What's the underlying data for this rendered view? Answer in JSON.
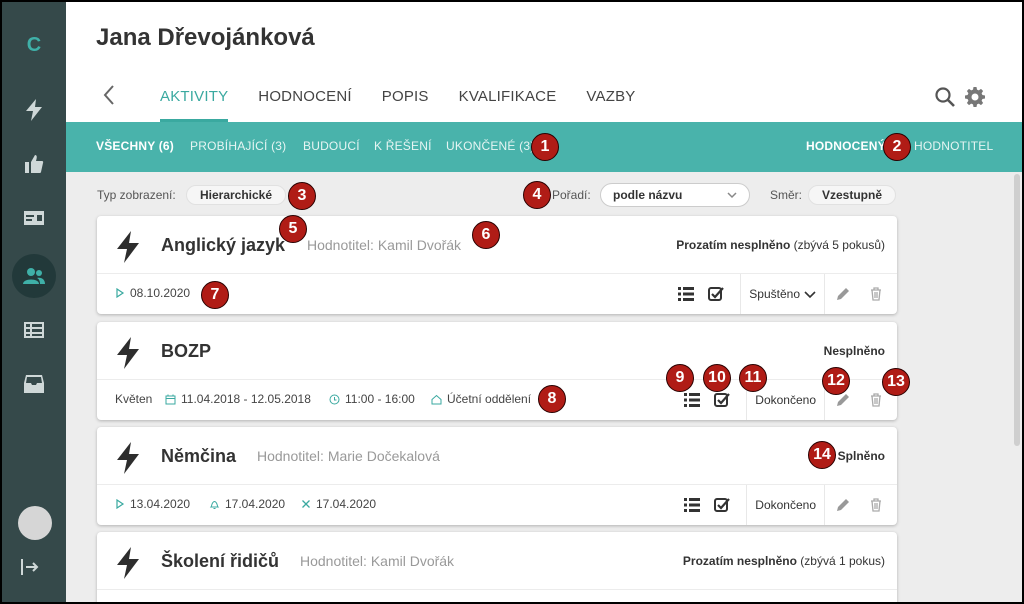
{
  "app": {
    "logo": "C"
  },
  "person": {
    "name": "Jana Dřevojánková"
  },
  "tabs": [
    "AKTIVITY",
    "HODNOCENÍ",
    "POPIS",
    "KVALIFIKACE",
    "VAZBY"
  ],
  "subtabs": [
    "VŠECHNY (6)",
    "PROBÍHAJÍCÍ (3)",
    "BUDOUCÍ",
    "K ŘEŠENÍ",
    "UKONČENÉ (3)"
  ],
  "role_tabs": [
    "HODNOCENÝ",
    "HODNOTITEL"
  ],
  "filters": {
    "view_label": "Typ zobrazení:",
    "view_value": "Hierarchické",
    "order_label": "Pořadí:",
    "order_value": "podle názvu",
    "direction_label": "Směr:",
    "direction_value": "Vzestupně"
  },
  "cards": [
    {
      "title": "Anglický jazyk",
      "evaluator": "Hodnotitel: Kamil Dvořák",
      "status_bold": "Prozatím nesplněno",
      "status_rest": " (zbývá 5 pokusů)",
      "meta": {
        "start": "08.10.2020"
      },
      "state": "Spuštěno"
    },
    {
      "title": "BOZP",
      "evaluator": "",
      "status_bold": "Nesplněno",
      "status_rest": "",
      "meta": {
        "month": "Květen",
        "dates": "11.04.2018 - 12.05.2018",
        "time": "11:00 - 16:00",
        "place": "Účetní oddělení"
      },
      "state": "Dokončeno"
    },
    {
      "title": "Němčina",
      "evaluator": "Hodnotitel: Marie Dočekalová",
      "status_bold": "Splněno",
      "status_rest": "",
      "meta": {
        "start": "13.04.2020",
        "reminder": "17.04.2020",
        "end": "17.04.2020"
      },
      "state": "Dokončeno"
    },
    {
      "title": "Školení řidičů",
      "evaluator": "Hodnotitel: Kamil Dvořák",
      "status_bold": "Prozatím nesplněno",
      "status_rest": " (zbývá 1 pokus)"
    }
  ],
  "badges": [
    "1",
    "2",
    "3",
    "4",
    "5",
    "6",
    "7",
    "8",
    "9",
    "10",
    "11",
    "12",
    "13",
    "14"
  ],
  "colors": {
    "accent": "#3aa9a0",
    "sidebar": "#35494a",
    "badge": "#b01c16"
  }
}
